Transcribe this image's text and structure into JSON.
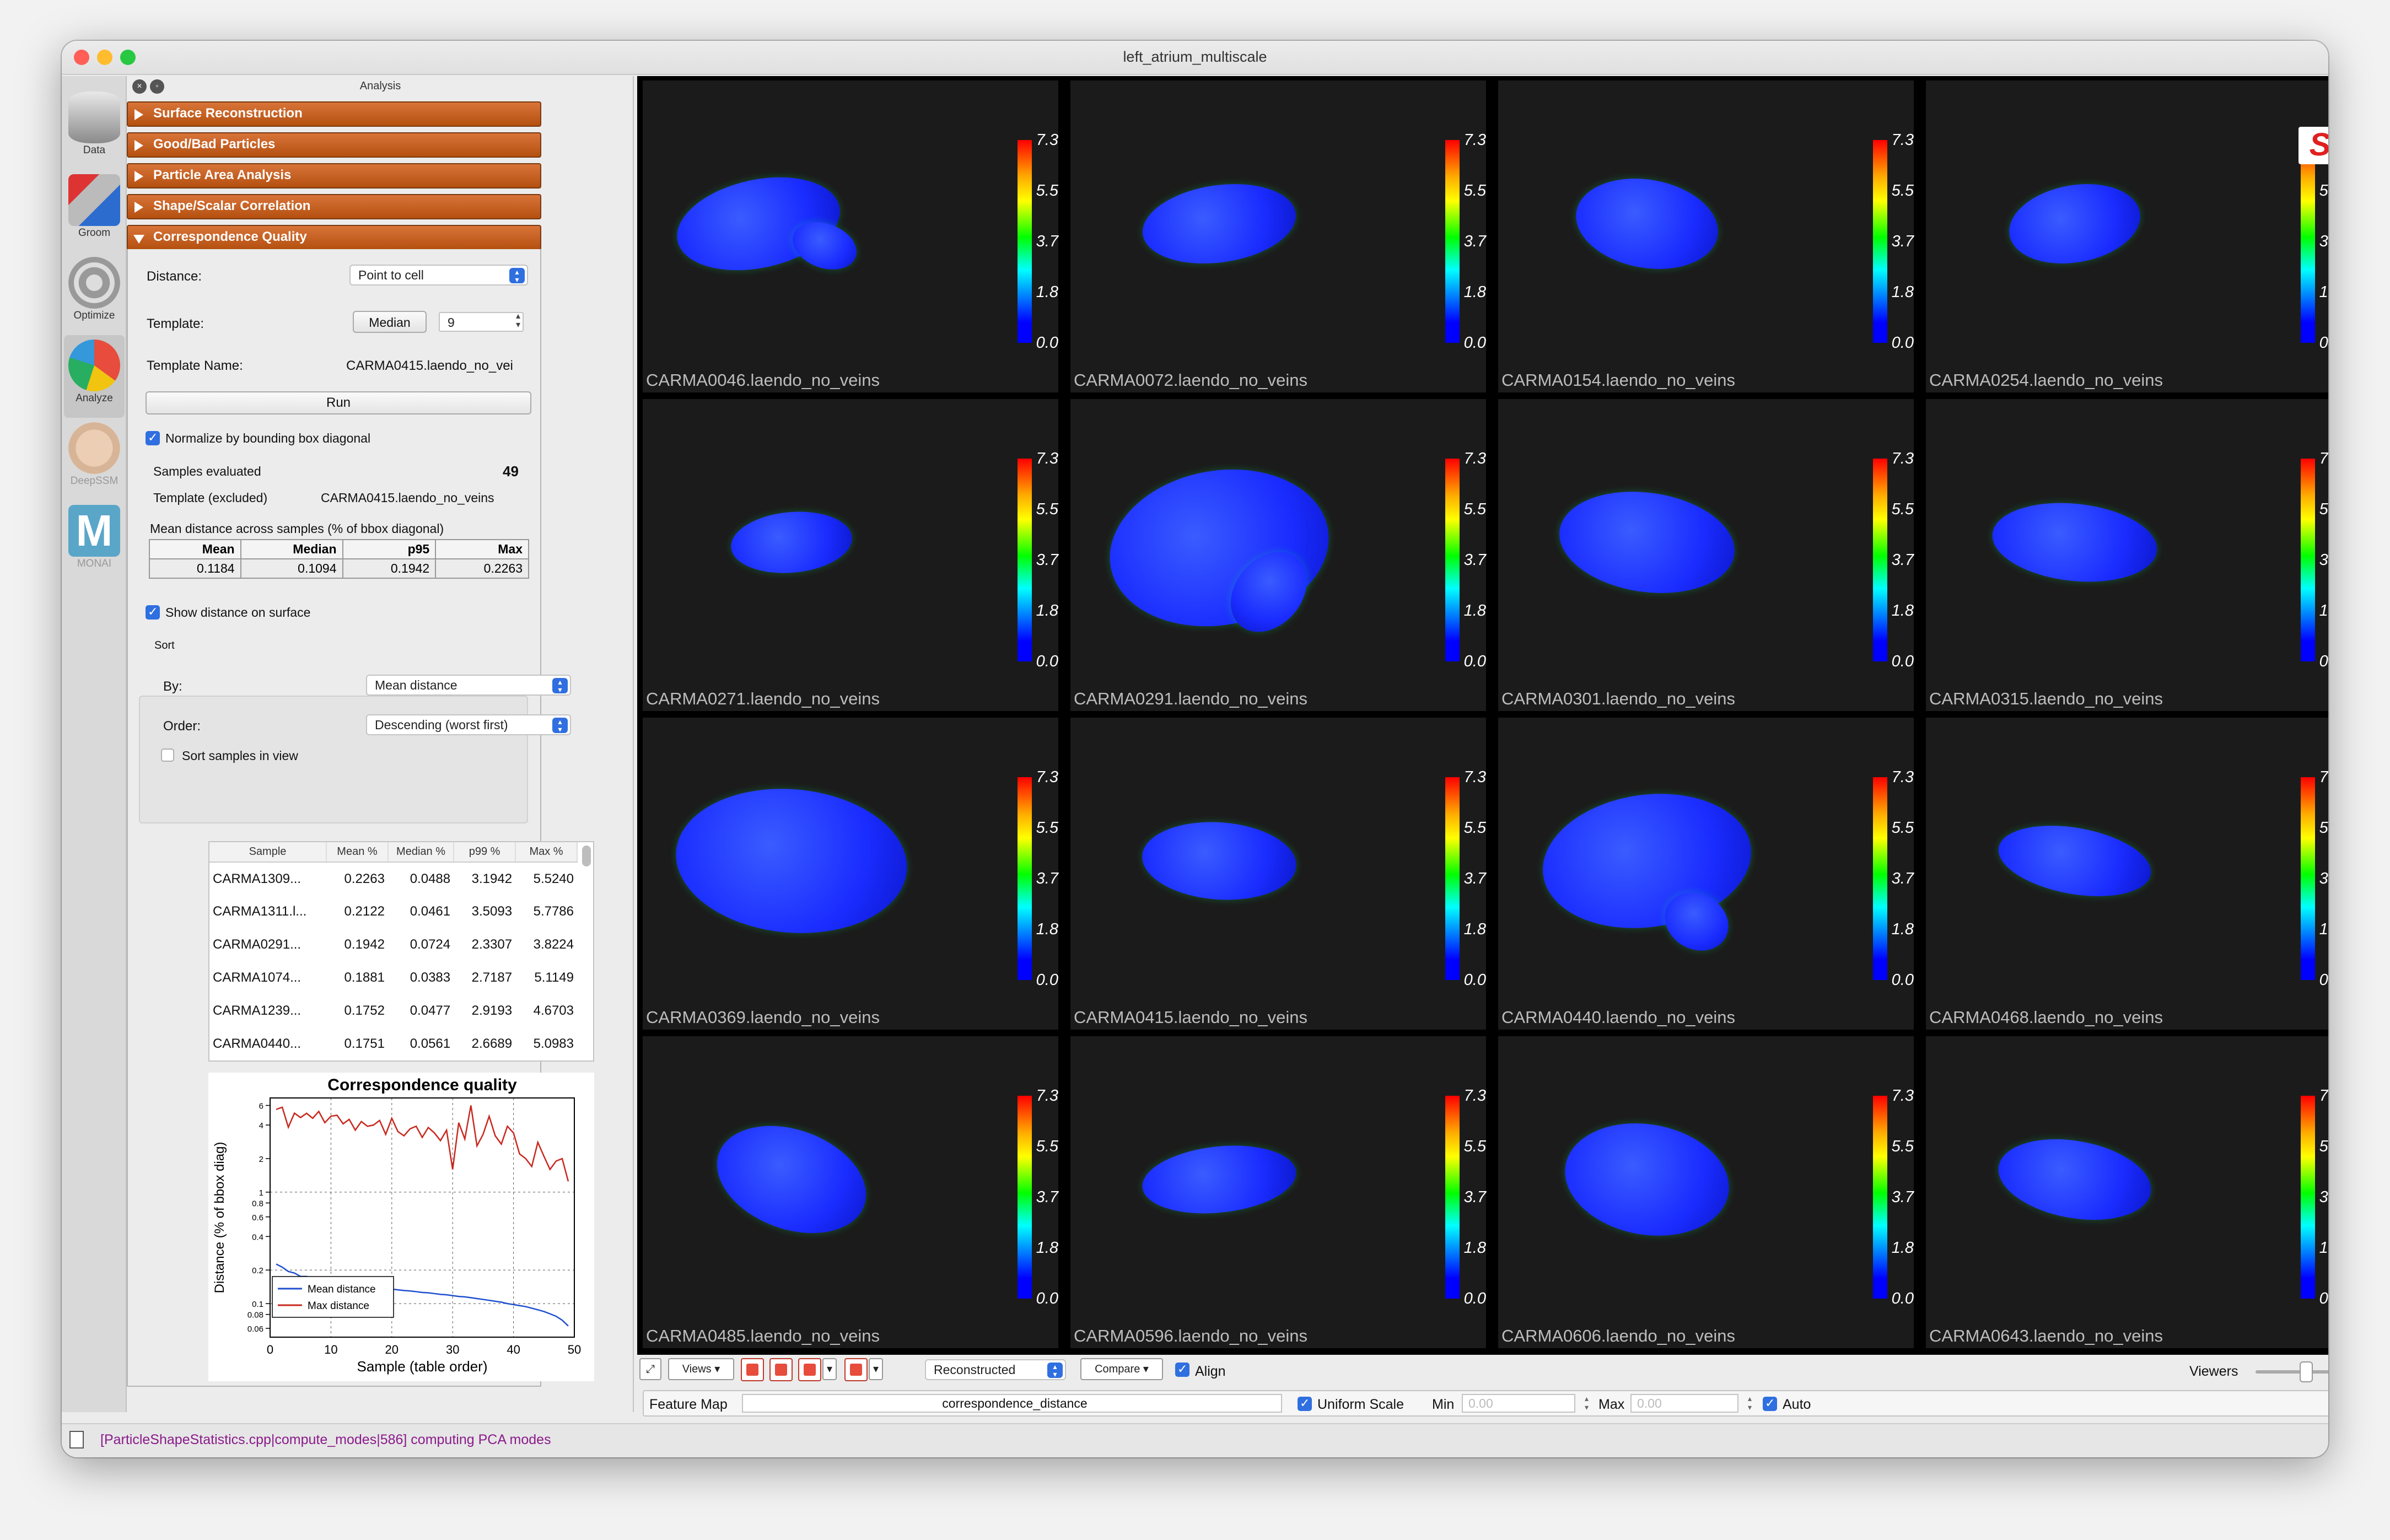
{
  "window": {
    "title": "left_atrium_multiscale"
  },
  "toolstrip": [
    {
      "label": "Data",
      "icon": "data-icon"
    },
    {
      "label": "Groom",
      "icon": "groom-icon"
    },
    {
      "label": "Optimize",
      "icon": "optimize-icon"
    },
    {
      "label": "Analyze",
      "icon": "analyze-icon"
    },
    {
      "label": "DeepSSM",
      "icon": "deepssm-icon"
    },
    {
      "label": "MONAI",
      "icon": "monai-icon"
    }
  ],
  "panel": {
    "title": "Analysis",
    "sections": [
      "Surface Reconstruction",
      "Good/Bad Particles",
      "Particle Area Analysis",
      "Shape/Scalar Correlation",
      "Correspondence Quality"
    ],
    "distance_label": "Distance:",
    "distance_value": "Point to cell",
    "template_label": "Template:",
    "template_mode": "Median",
    "template_number": "9",
    "template_name_label": "Template Name:",
    "template_name_value": "CARMA0415.laendo_no_vei",
    "run_label": "Run",
    "normalize_label": "Normalize by bounding box diagonal",
    "samples_evaluated_label": "Samples evaluated",
    "samples_evaluated_value": "49",
    "template_excluded_label": "Template (excluded)",
    "template_excluded_value": "CARMA0415.laendo_no_veins",
    "mean_distance_caption": "Mean distance across samples (% of bbox diagonal)",
    "stats_headers": [
      "Mean",
      "Median",
      "p95",
      "Max"
    ],
    "stats_values": [
      "0.1184",
      "0.1094",
      "0.1942",
      "0.2263"
    ],
    "show_distance_label": "Show distance on surface",
    "sort": {
      "title": "Sort",
      "by_label": "By:",
      "by_value": "Mean distance",
      "order_label": "Order:",
      "order_value": "Descending (worst first)",
      "in_view_label": "Sort samples in view"
    },
    "table": {
      "headers": [
        "Sample",
        "Mean %",
        "Median %",
        "p99 %",
        "Max %"
      ],
      "rows": [
        [
          "CARMA1309...",
          "0.2263",
          "0.0488",
          "3.1942",
          "5.5240"
        ],
        [
          "CARMA1311.l...",
          "0.2122",
          "0.0461",
          "3.5093",
          "5.7786"
        ],
        [
          "CARMA0291...",
          "0.1942",
          "0.0724",
          "2.3307",
          "3.8224"
        ],
        [
          "CARMA1074...",
          "0.1881",
          "0.0383",
          "2.7187",
          "5.1149"
        ],
        [
          "CARMA1239...",
          "0.1752",
          "0.0477",
          "2.9193",
          "4.6703"
        ],
        [
          "CARMA0440...",
          "0.1751",
          "0.0561",
          "2.6689",
          "5.0983"
        ]
      ]
    }
  },
  "chart_data": {
    "type": "line",
    "title": "Correspondence quality",
    "xlabel": "Sample (table order)",
    "ylabel": "Distance (% of bbox diag)",
    "xlim": [
      0,
      50
    ],
    "ylim": [
      0.05,
      7
    ],
    "yscale": "log",
    "xticks": [
      "0",
      "10",
      "20",
      "30",
      "40",
      "50"
    ],
    "yticks": [
      "0.06",
      "0.08",
      "0.1",
      "0.2",
      "0.4",
      "0.6",
      "0.8",
      "1",
      "2",
      "4",
      "6"
    ],
    "grid": true,
    "legend": "bottom-left",
    "series": [
      {
        "name": "Mean distance",
        "color": "#1f4fd0",
        "x": [
          1,
          2,
          3,
          4,
          5,
          6,
          7,
          8,
          9,
          10,
          11,
          12,
          13,
          14,
          15,
          16,
          17,
          18,
          19,
          20,
          21,
          22,
          23,
          24,
          25,
          26,
          27,
          28,
          29,
          30,
          31,
          32,
          33,
          34,
          35,
          36,
          37,
          38,
          39,
          40,
          41,
          42,
          43,
          44,
          45,
          46,
          47,
          48,
          49
        ],
        "values": [
          0.2263,
          0.2122,
          0.1942,
          0.1881,
          0.1752,
          0.1751,
          0.168,
          0.165,
          0.161,
          0.158,
          0.155,
          0.152,
          0.149,
          0.147,
          0.145,
          0.143,
          0.141,
          0.139,
          0.137,
          0.135,
          0.133,
          0.131,
          0.13,
          0.128,
          0.126,
          0.125,
          0.123,
          0.121,
          0.12,
          0.118,
          0.116,
          0.115,
          0.113,
          0.111,
          0.109,
          0.107,
          0.105,
          0.103,
          0.1,
          0.098,
          0.096,
          0.094,
          0.091,
          0.088,
          0.085,
          0.081,
          0.077,
          0.071,
          0.063
        ]
      },
      {
        "name": "Max distance",
        "color": "#c8281e",
        "x": [
          1,
          2,
          3,
          4,
          5,
          6,
          7,
          8,
          9,
          10,
          11,
          12,
          13,
          14,
          15,
          16,
          17,
          18,
          19,
          20,
          21,
          22,
          23,
          24,
          25,
          26,
          27,
          28,
          29,
          30,
          31,
          32,
          33,
          34,
          35,
          36,
          37,
          38,
          39,
          40,
          41,
          42,
          43,
          44,
          45,
          46,
          47,
          48,
          49
        ],
        "values": [
          5.524,
          5.779,
          3.822,
          5.115,
          4.67,
          5.098,
          4.6,
          5.3,
          4.2,
          4.8,
          4.9,
          4.1,
          4.5,
          3.6,
          4.3,
          3.9,
          4.0,
          4.4,
          3.3,
          4.6,
          3.5,
          3.2,
          3.7,
          3.9,
          3.1,
          3.8,
          3.4,
          2.9,
          3.6,
          1.6,
          4.2,
          3.0,
          6.0,
          2.6,
          3.3,
          4.8,
          3.2,
          2.7,
          3.9,
          3.4,
          2.2,
          2.0,
          1.7,
          2.8,
          2.1,
          1.6,
          1.9,
          2.0,
          1.25
        ]
      }
    ]
  },
  "viewer": {
    "colorbar_ticks": [
      "7.3",
      "5.5",
      "3.7",
      "1.8",
      "0.0"
    ],
    "samples": [
      "CARMA0046.laendo_no_veins",
      "CARMA0072.laendo_no_veins",
      "CARMA0154.laendo_no_veins",
      "CARMA0254.laendo_no_veins",
      "CARMA0271.laendo_no_veins",
      "CARMA0291.laendo_no_veins",
      "CARMA0301.laendo_no_veins",
      "CARMA0315.laendo_no_veins",
      "CARMA0369.laendo_no_veins",
      "CARMA0415.laendo_no_veins",
      "CARMA0440.laendo_no_veins",
      "CARMA0468.laendo_no_veins",
      "CARMA0485.laendo_no_veins",
      "CARMA0596.laendo_no_veins",
      "CARMA0606.laendo_no_veins",
      "CARMA0643.laendo_no_veins"
    ],
    "logo": "S"
  },
  "toolbar": {
    "views_label": "Views",
    "mode_value": "Reconstructed",
    "compare_label": "Compare",
    "align_label": "Align",
    "viewers_label": "Viewers"
  },
  "featuremap": {
    "label": "Feature Map",
    "value": "correspondence_distance",
    "uniform_scale_label": "Uniform Scale",
    "min_label": "Min",
    "min_value": "0.00",
    "max_label": "Max",
    "max_value": "0.00",
    "auto_label": "Auto"
  },
  "status": {
    "message": "[ParticleShapeStatistics.cpp|compute_modes|586] computing PCA modes"
  },
  "colors": {
    "section": "#c0601e",
    "accent": "#2f6fe0",
    "mesh": "#1a2cff"
  }
}
